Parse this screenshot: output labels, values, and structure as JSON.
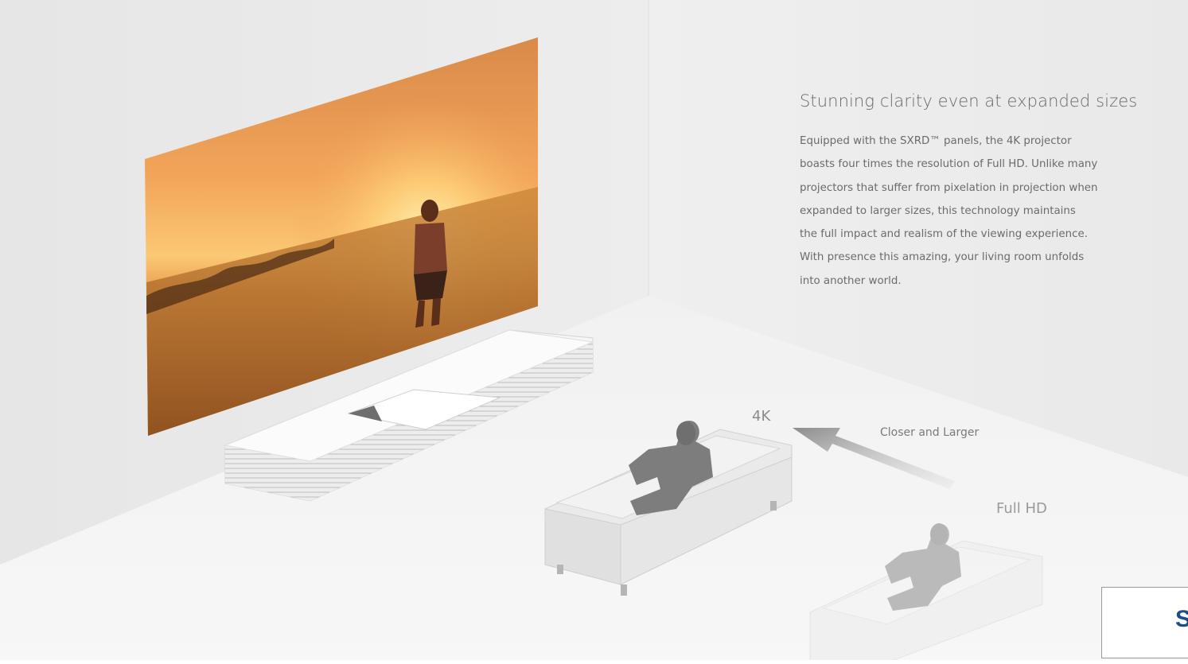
{
  "feature": {
    "headline": "Stunning clarity even at expanded sizes",
    "body_lines": [
      "Equipped with the SXRD™ panels, the 4K projector",
      "boasts four times the resolution of Full HD. Unlike many",
      "projectors that suffer from pixelation in projection when",
      "expanded to larger sizes, this technology maintains",
      "the full impact and realism of the viewing experience.",
      "With presence this amazing, your living room unfolds",
      "into another world."
    ]
  },
  "illustration": {
    "label_4k": "4K",
    "label_fullhd": "Full HD",
    "arrow_caption": "Closer and Larger"
  },
  "corner_badge": {
    "letter": "S"
  },
  "colors": {
    "wall": "#ececec",
    "floor": "#f4f4f4",
    "accent_blue": "#1a4f8a"
  }
}
